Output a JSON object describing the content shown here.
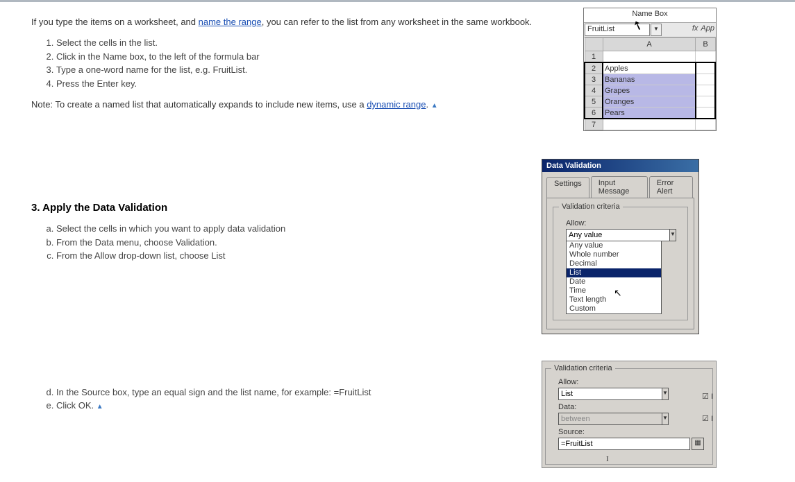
{
  "intro": {
    "text_prefix": "If you type the items on a worksheet, and ",
    "link1": "name the range",
    "text_suffix": ", you can refer to the list from any worksheet in the same workbook.",
    "steps": [
      "Select the cells in the list.",
      "Click in the Name box, to the left of the formula bar",
      "Type a one-word name for the list, e.g. FruitList.",
      "Press the Enter key."
    ],
    "note_prefix": "Note: To create a named list that automatically expands to include new items, use a ",
    "note_link": "dynamic range",
    "note_suffix": ". "
  },
  "section3": {
    "heading": "3. Apply the Data Validation",
    "steps_a": [
      "Select the cells in which you want to apply data validation",
      "From the Data menu, choose Validation.",
      "From the Allow drop-down list, choose List"
    ],
    "steps_b": [
      "In the Source box, type an equal sign and the list name, for example: =FruitList",
      "Click OK. "
    ]
  },
  "fig_namebox": {
    "label": "Name Box",
    "value": "FruitList",
    "fx": "fx",
    "fbar": "App",
    "col_a": "A",
    "col_b": "B",
    "rows": [
      "",
      "Apples",
      "Bananas",
      "Grapes",
      "Oranges",
      "Pears",
      ""
    ]
  },
  "fig_dv": {
    "title": "Data Validation",
    "tabs": [
      "Settings",
      "Input Message",
      "Error Alert"
    ],
    "legend": "Validation criteria",
    "allow_label": "Allow:",
    "allow_value": "Any value",
    "options": [
      "Any value",
      "Whole number",
      "Decimal",
      "List",
      "Date",
      "Time",
      "Text length",
      "Custom"
    ],
    "highlight_index": 3
  },
  "fig_crit": {
    "legend": "Validation criteria",
    "allow_label": "Allow:",
    "allow_value": "List",
    "data_label": "Data:",
    "data_value": "between",
    "source_label": "Source:",
    "source_value": "=FruitList",
    "check1": "I",
    "check2": "I"
  }
}
